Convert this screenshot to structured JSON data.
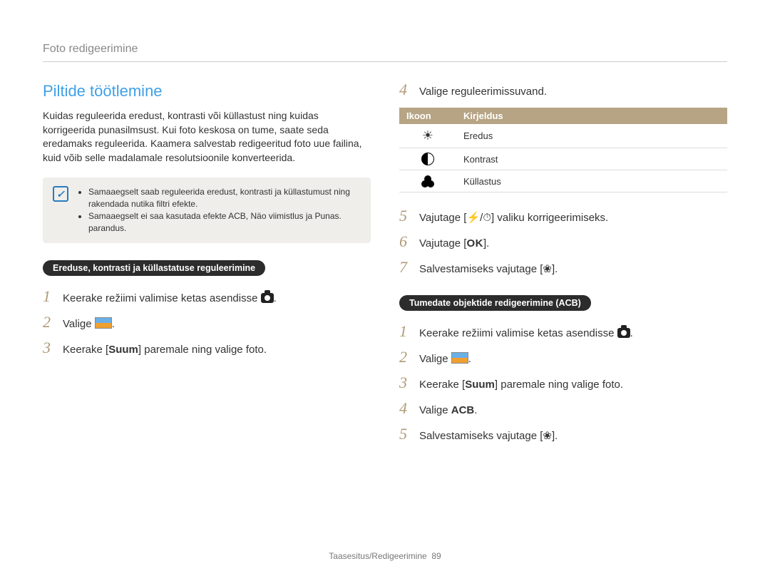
{
  "header": "Foto redigeerimine",
  "left": {
    "title": "Piltide töötlemine",
    "intro": "Kuidas reguleerida eredust, kontrasti või küllastust ning kuidas korrigeerida punasilmsust. Kui foto keskosa on tume, saate seda eredamaks reguleerida. Kaamera salvestab redigeeritud foto uue failina, kuid võib selle madalamale resolutsioonile konverteerida.",
    "note1": "Samaaegselt saab reguleerida eredust, kontrasti ja küllastumust ning rakendada nutika filtri efekte.",
    "note2": "Samaaegselt ei saa kasutada efekte ACB, Näo viimistlus ja Punas. parandus.",
    "pill": "Ereduse, kontrasti ja küllastatuse reguleerimine",
    "step1": "Keerake režiimi valimise ketas asendisse ",
    "step2": "Valige ",
    "step3_a": "Keerake [",
    "step3_b": "Suum",
    "step3_c": "] paremale ning valige foto."
  },
  "right": {
    "step4": "Valige reguleerimissuvand.",
    "table": {
      "h1": "Ikoon",
      "h2": "Kirjeldus",
      "r1": "Eredus",
      "r2": "Kontrast",
      "r3": "Küllastus"
    },
    "step5_a": "Vajutage [",
    "step5_b": "] valiku korrigeerimiseks.",
    "step6_a": "Vajutage [",
    "step6_b": "].",
    "step7_a": "Salvestamiseks vajutage [",
    "step7_b": "].",
    "pill": "Tumedate objektide redigeerimine (ACB)",
    "b_step1": "Keerake režiimi valimise ketas asendisse ",
    "b_step2": "Valige ",
    "b_step3_a": "Keerake [",
    "b_step3_b": "Suum",
    "b_step3_c": "] paremale ning valige foto.",
    "b_step4_a": "Valige ",
    "b_step4_b": "ACB",
    "b_step5_a": "Salvestamiseks vajutage [",
    "b_step5_b": "]."
  },
  "footer": {
    "section": "Taasesitus/Redigeerimine",
    "page": "89"
  },
  "icons": {
    "ok": "OK"
  }
}
